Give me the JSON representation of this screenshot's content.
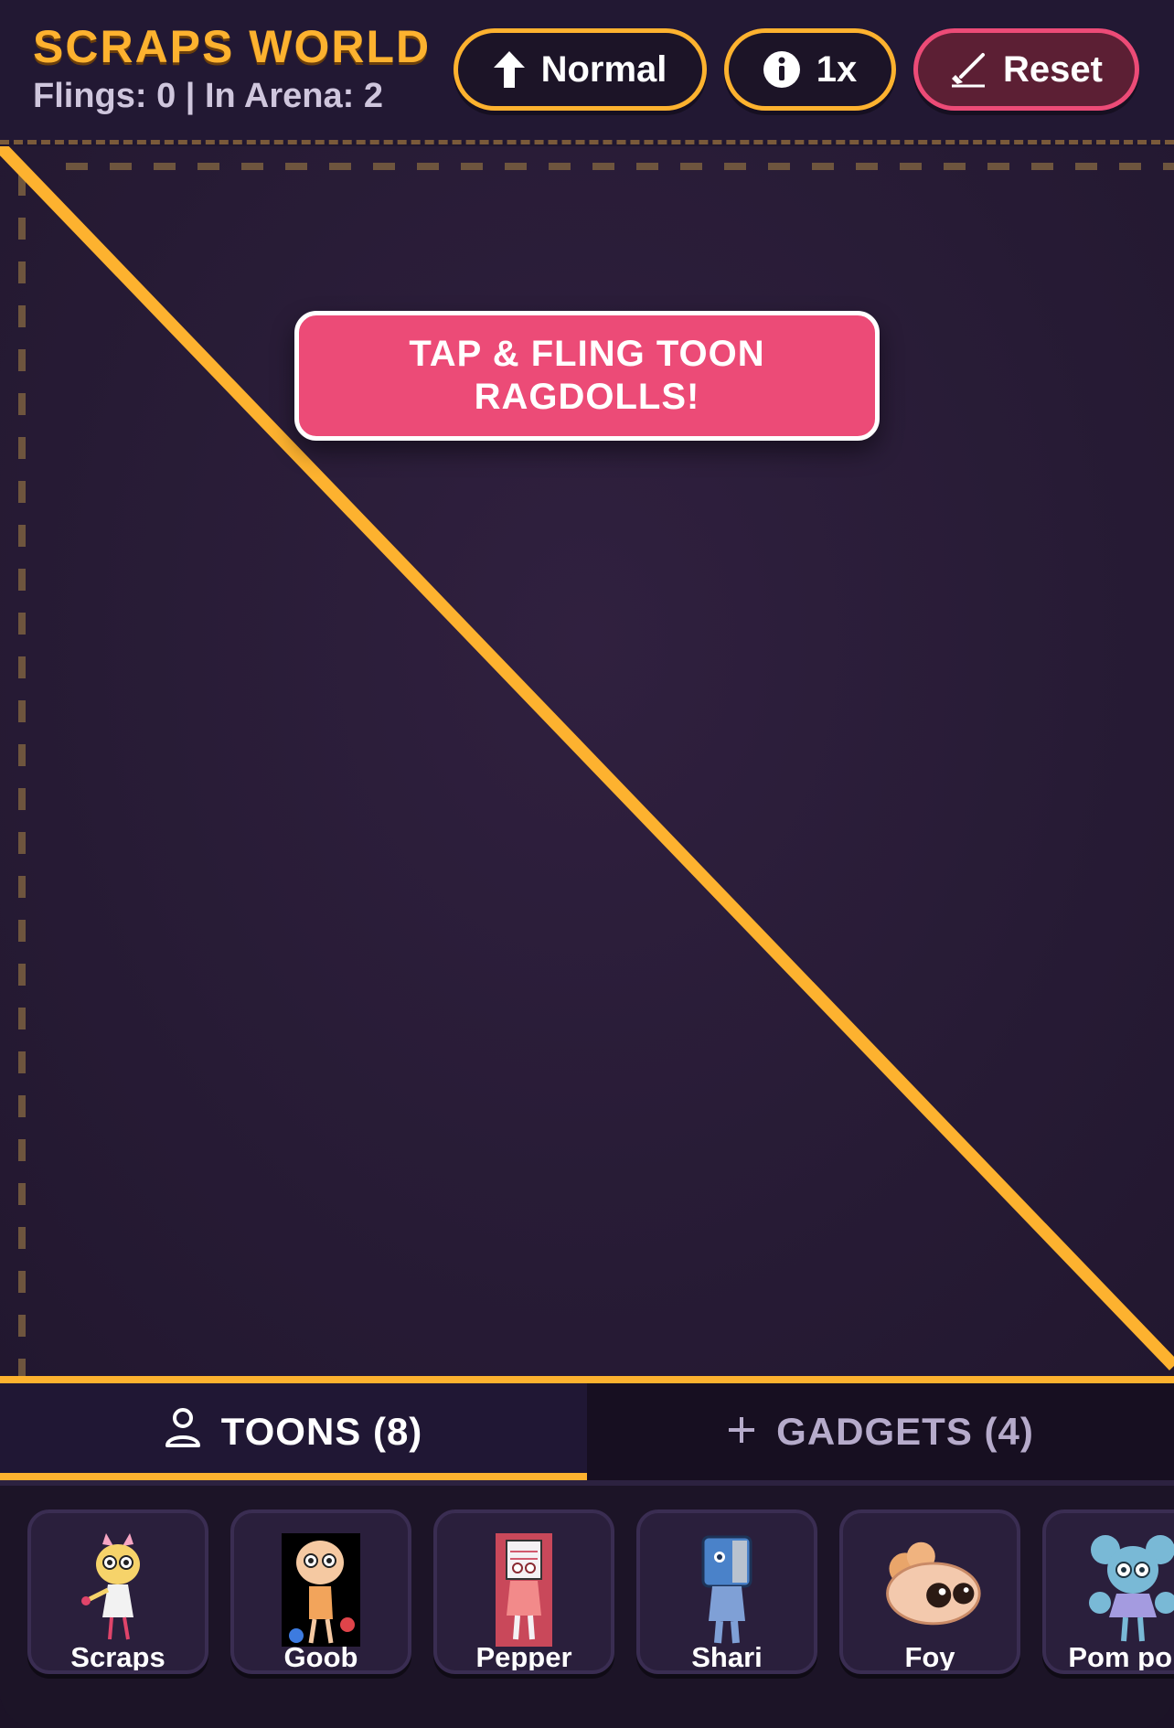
{
  "header": {
    "title": "SCRAPS WORLD",
    "stats": "Flings: 0 | In Arena: 2",
    "gravity_label": "Normal",
    "speed_label": "1x",
    "reset_label": "Reset"
  },
  "arena": {
    "banner": "TAP & FLING TOON\nRAGDOLLS!"
  },
  "tabs": {
    "toons": "TOONS (8)",
    "gadgets": "GADGETS (4)",
    "active": "toons"
  },
  "toons": [
    {
      "name": "Scraps",
      "icon": "scraps-icon"
    },
    {
      "name": "Goob",
      "icon": "goob-icon"
    },
    {
      "name": "Pepper",
      "icon": "pepper-icon"
    },
    {
      "name": "Shari",
      "icon": "shari-icon"
    },
    {
      "name": "Foy",
      "icon": "foy-icon"
    },
    {
      "name": "Pom pom",
      "icon": "pompom-icon"
    }
  ],
  "colors": {
    "accent": "#fdb22f",
    "danger": "#ec4b77",
    "background": "#1f1630"
  }
}
